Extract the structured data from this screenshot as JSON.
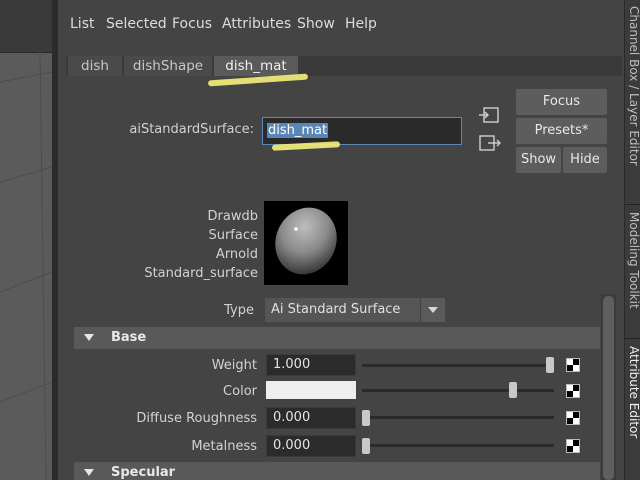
{
  "menu": {
    "items": [
      "List",
      "Selected",
      "Focus",
      "Attributes",
      "Show",
      "Help"
    ]
  },
  "tabs": [
    {
      "label": "dish",
      "active": false
    },
    {
      "label": "dishShape",
      "active": false
    },
    {
      "label": "dish_mat",
      "active": true
    }
  ],
  "node": {
    "type_label": "aiStandardSurface:",
    "name_value": "dish_mat"
  },
  "buttons": {
    "focus": "Focus",
    "presets": "Presets*",
    "show": "Show",
    "hide": "Hide"
  },
  "swatch": {
    "caption_lines": [
      "Drawdb",
      "Surface",
      "Arnold",
      "Standard_surface"
    ]
  },
  "type_row": {
    "label": "Type",
    "value": "Ai Standard Surface"
  },
  "sections": {
    "base": "Base",
    "specular": "Specular"
  },
  "attributes": [
    {
      "label": "Weight",
      "value": "1.000",
      "slider": 1.0
    },
    {
      "label": "Color",
      "value": "",
      "swatch_color": "#eeeeee",
      "slider": 0.8
    },
    {
      "label": "Diffuse Roughness",
      "value": "0.000",
      "slider": 0.0
    },
    {
      "label": "Metalness",
      "value": "0.000",
      "slider": 0.0
    }
  ],
  "side_tabs": [
    "Channel Box / Layer Editor",
    "Modeling Toolkit",
    "Attribute Editor"
  ],
  "colors": {
    "accent_highlight": "#f6f07a",
    "selection": "#5a86b5"
  }
}
